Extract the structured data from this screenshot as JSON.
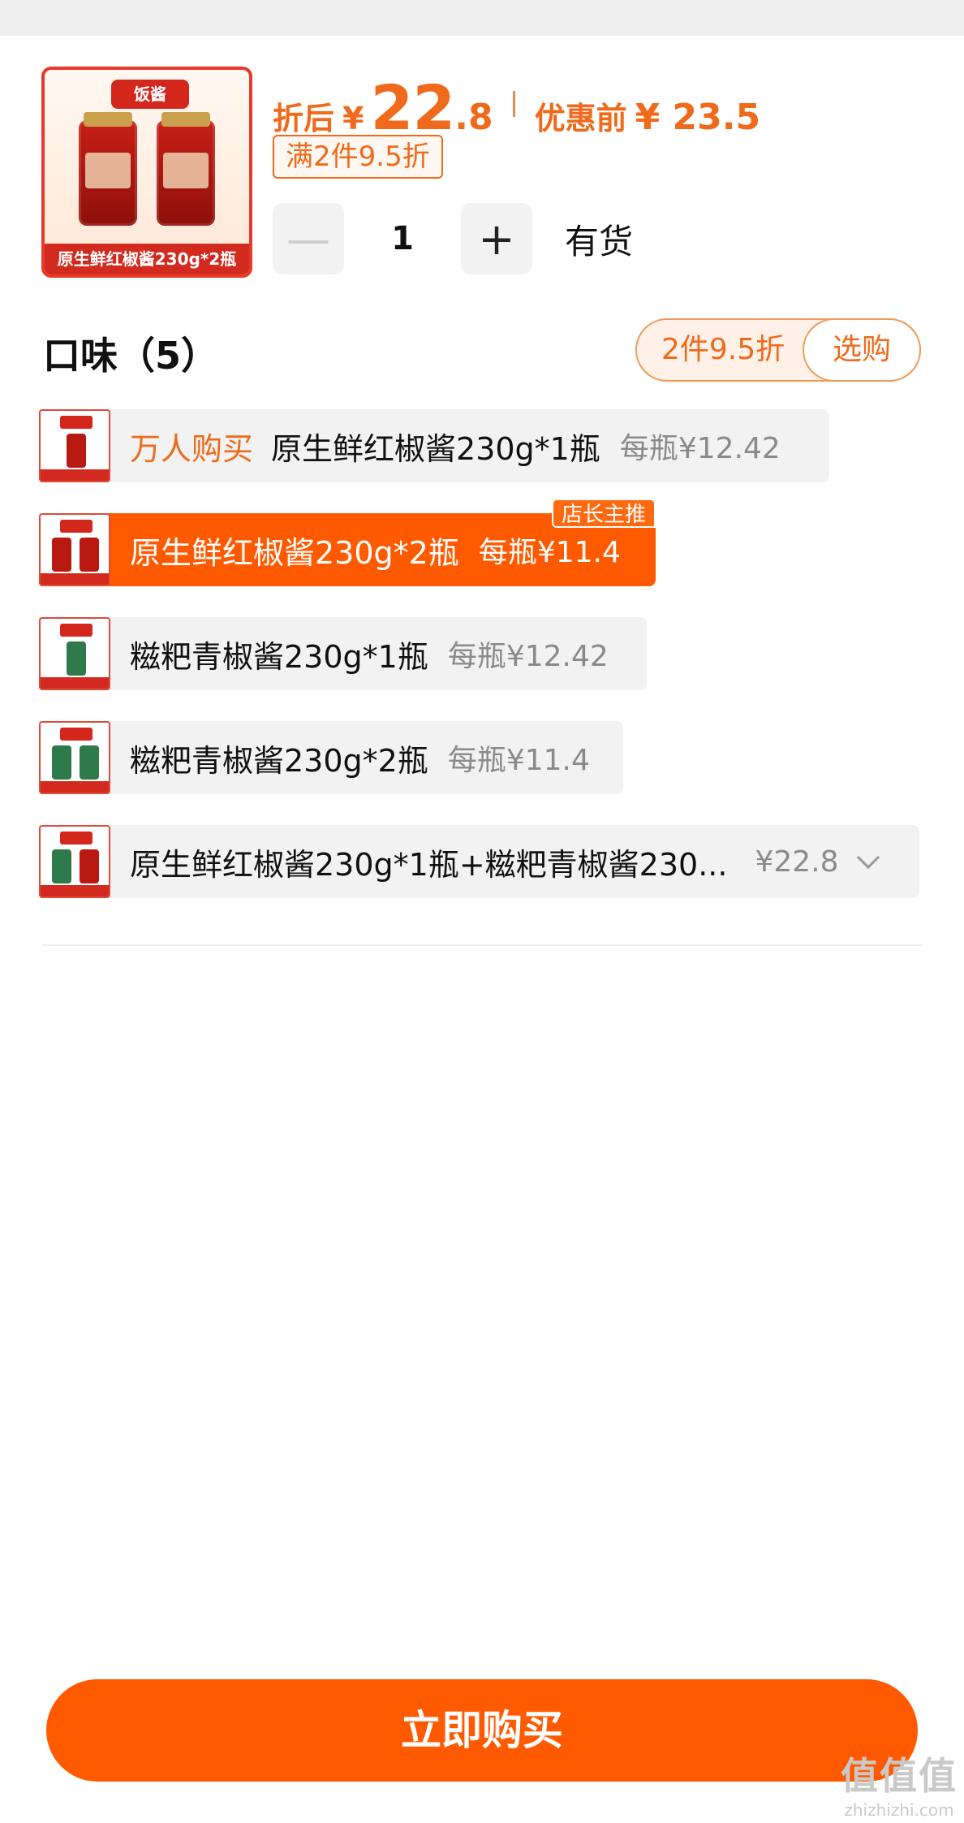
{
  "product": {
    "caption": "原生鲜红椒酱230g*2瓶",
    "logo_text": "饭酱"
  },
  "price": {
    "after_label": "折后",
    "currency": "¥",
    "integer": "22",
    "decimal": ".8",
    "before_label": "优惠前",
    "before_price": "¥ 23.5"
  },
  "promo_tag": "满2件9.5折",
  "quantity": {
    "minus": "—",
    "value": "1",
    "plus": "+",
    "stock": "有货"
  },
  "flavor": {
    "title": "口味（5）",
    "deal_text": "2件9.5折",
    "deal_button": "选购"
  },
  "options": [
    {
      "hot": "万人购买",
      "name": "原生鲜红椒酱230g*1瓶",
      "price": "每瓶¥12.42"
    },
    {
      "name": "原生鲜红椒酱230g*2瓶",
      "price": "每瓶¥11.4",
      "badge": "店长主推"
    },
    {
      "name": "糍粑青椒酱230g*1瓶",
      "price": "每瓶¥12.42"
    },
    {
      "name": "糍粑青椒酱230g*2瓶",
      "price": "每瓶¥11.4"
    },
    {
      "name": "原生鲜红椒酱230g*1瓶+糍粑青椒酱230...",
      "price": "¥22.8"
    }
  ],
  "buy_button": "立即购买",
  "watermark": {
    "mark": "值值值",
    "url": "zhizhizhi.com"
  },
  "colors": {
    "accent": "#ff5a00",
    "price": "#ef6a1a"
  }
}
